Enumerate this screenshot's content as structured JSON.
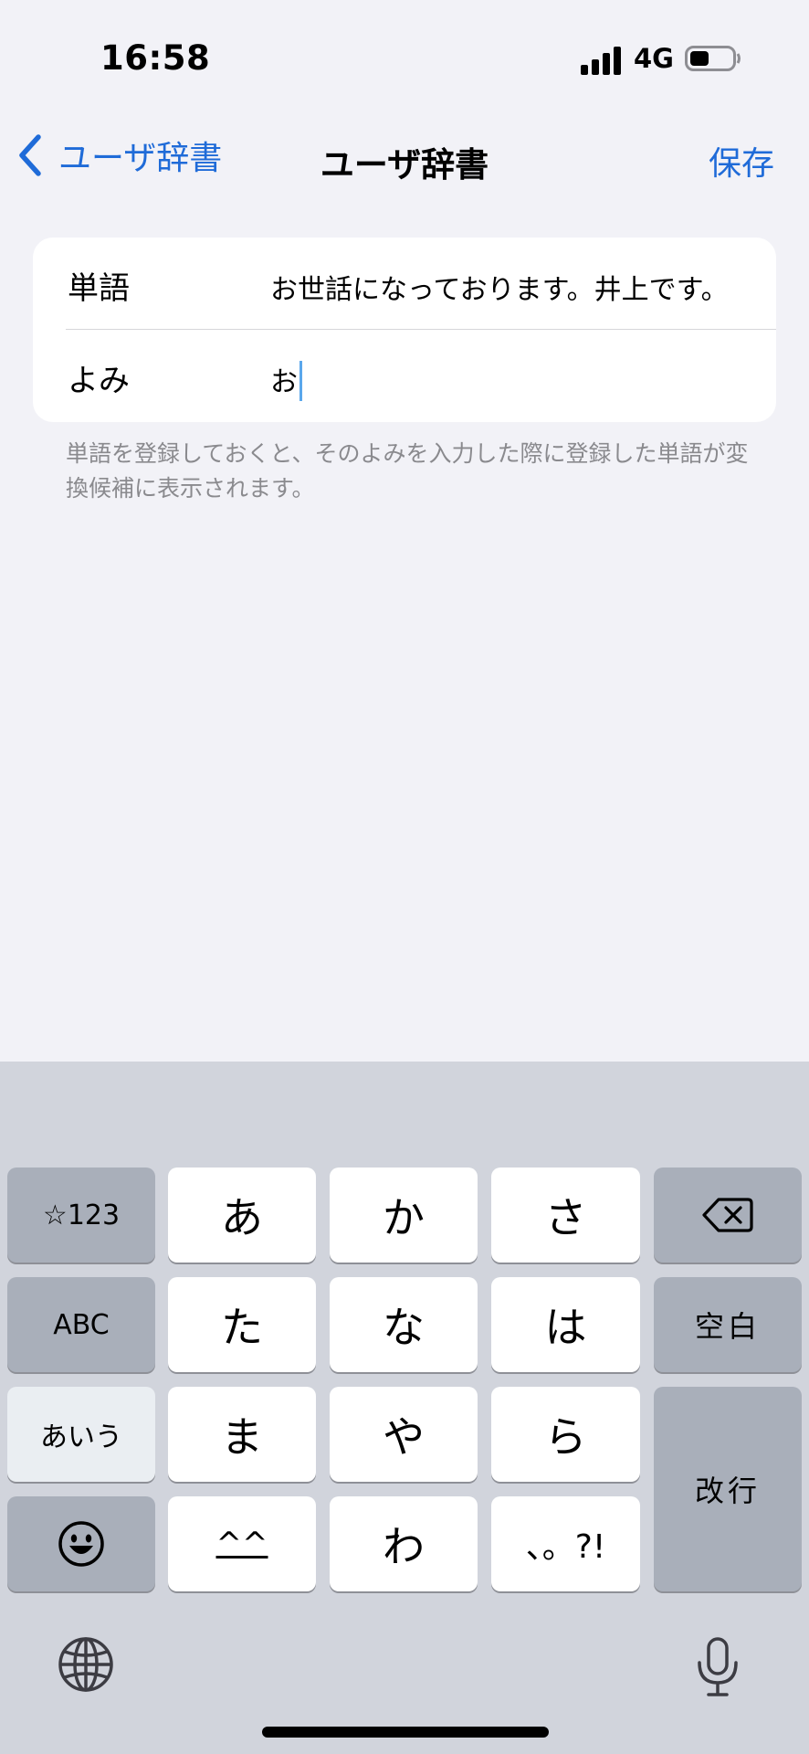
{
  "status_bar": {
    "time": "16:58",
    "network": "4G",
    "battery_level": 0.45
  },
  "nav": {
    "back_label": "ユーザ辞書",
    "title": "ユーザ辞書",
    "save_label": "保存"
  },
  "form": {
    "word_label": "単語",
    "word_value": "お世話になっております。井上です。",
    "reading_label": "よみ",
    "reading_value": "お"
  },
  "helper_text": "単語を登録しておくと、そのよみを入力した際に登録した単語が変換候補に表示されます。",
  "keyboard": {
    "symbols_key": "☆123",
    "abc_key": "ABC",
    "kana_mode_key": "あいう",
    "emoji_key": "😀",
    "keys": [
      "あ",
      "か",
      "さ",
      "た",
      "な",
      "は",
      "ま",
      "や",
      "ら",
      "^^",
      "わ",
      "、。?!"
    ],
    "space_key": "空白",
    "return_key": "改行",
    "delete_icon": "delete-backward-icon",
    "globe_icon": "globe-icon",
    "mic_icon": "microphone-icon"
  }
}
